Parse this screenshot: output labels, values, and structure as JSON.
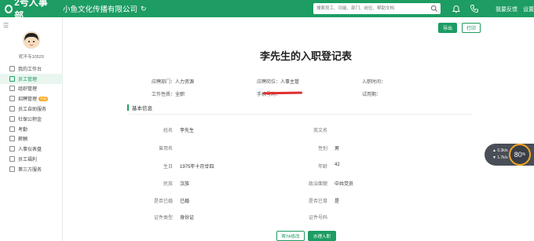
{
  "header": {
    "logo": "2号人事部",
    "company": "小鱼文化传播有限公司",
    "search_placeholder": "搜索员工、功能、部门、岗位、帮助文档",
    "feedback": "我要反馈",
    "settings": "设置"
  },
  "sidebar": {
    "username": "昵不专10520",
    "items": [
      {
        "label": "我的工作台"
      },
      {
        "label": "员工管理"
      },
      {
        "label": "组织管理"
      },
      {
        "label": "招聘管理",
        "badge": "升级"
      },
      {
        "label": "员工自助服务"
      },
      {
        "label": "社保公积金"
      },
      {
        "label": "考勤"
      },
      {
        "label": "薪酬"
      },
      {
        "label": "人事仪表盘"
      },
      {
        "label": "员工福利"
      },
      {
        "label": "第三方服务"
      }
    ]
  },
  "toolbar": {
    "export": "导出",
    "print": "打印"
  },
  "doc": {
    "title": "李先生的入职登记表",
    "dept_label": "应聘部门：",
    "dept_value": "人力资源",
    "position_label": "应聘岗位：",
    "position_value": "人事主管",
    "entry_time_label": "入职时间：",
    "entry_time_value": "",
    "work_nature_label": "工作性质：",
    "work_nature_value": "全职",
    "phone_label": "手机号码：",
    "probation_label": "试用期：",
    "probation_value": "",
    "section": "基本信息"
  },
  "fields": {
    "name_label": "姓名",
    "name_value": "李先生",
    "en_name_label": "英文名",
    "en_name_value": "",
    "former_label": "曾用名",
    "former_value": "",
    "gender_label": "性别",
    "gender_value": "男",
    "birth_label": "生日",
    "birth_value": "1975年十月廿四",
    "age_label": "年龄",
    "age_value": "42",
    "ethnic_label": "民族",
    "ethnic_value": "汉族",
    "political_label": "政治面貌",
    "political_value": "中共党员",
    "married_label": "是否已婚",
    "married_value": "已婚",
    "children_label": "是否已育",
    "children_value": "是",
    "id_type_label": "证件类型",
    "id_type_value": "身份证",
    "id_no_label": "证件号码",
    "id_no_value": ""
  },
  "actions": {
    "help_edit": "帮TA修改",
    "confirm": "办理入职"
  },
  "speed_widget": {
    "up": "0.3",
    "down": "1.7",
    "unit": "k/s",
    "percent": "80"
  },
  "colors": {
    "brand": "#1d9c63",
    "badge": "#f5a623"
  }
}
